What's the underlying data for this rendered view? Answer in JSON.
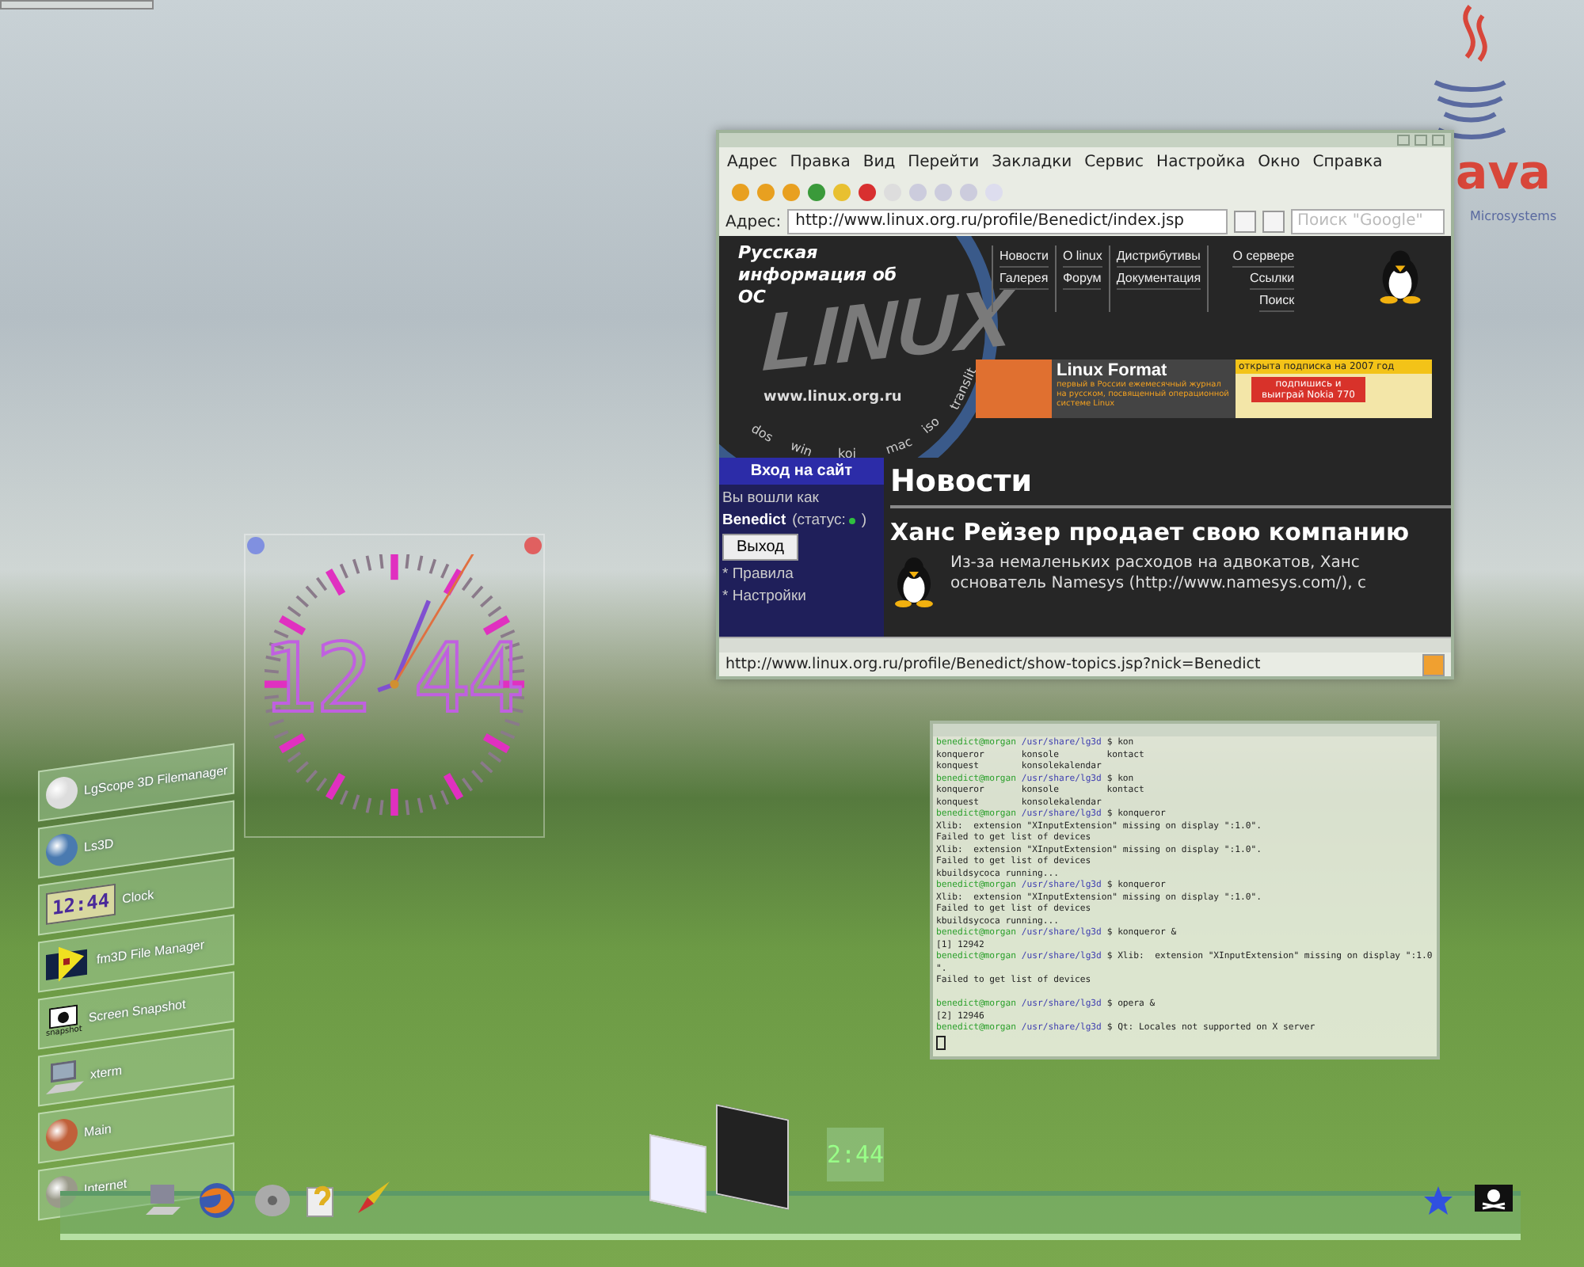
{
  "java_logo": {
    "wordmark": "ava",
    "company": "Microsystems"
  },
  "browser": {
    "menu": [
      "Адрес",
      "Правка",
      "Вид",
      "Перейти",
      "Закладки",
      "Сервис",
      "Настройка",
      "Окно",
      "Справка"
    ],
    "address_label": "Адрес:",
    "url": "http://www.linux.org.ru/profile/Benedict/index.jsp",
    "search_placeholder": "Поиск \"Google\"",
    "site": {
      "tagline": "Русская информация об ОС",
      "logo": "LINUX",
      "site_url": "www.linux.org.ru",
      "ring_words": [
        "dos",
        "win",
        "koi",
        "mac",
        "iso",
        "translit"
      ],
      "nav_columns": [
        [
          "Новости",
          "Галерея"
        ],
        [
          "О linux",
          "Форум"
        ],
        [
          "Дистрибутивы",
          "Документация"
        ],
        [
          "О сервере",
          "Ссылки",
          "Поиск"
        ]
      ],
      "banner": {
        "title": "Linux Format",
        "ribbon": "открыта подписка на 2007 год",
        "description": "первый в России ежемесячный журнал на русском, посвященный операционной системе Linux",
        "promo": "подпишись и выиграй Nokia 770"
      },
      "login": {
        "title": "Вход на сайт",
        "signed_in": "Вы вошли как",
        "user": "Benedict",
        "status_open": "(статус:",
        "status_dot": {
          "color": "#2fbf3f"
        },
        "status_close": ")",
        "logout": "Выход",
        "links": [
          "* Правила",
          "* Настройки"
        ]
      },
      "news_heading": "Новости",
      "article_title": "Ханс Рейзер продает свою компанию",
      "article_lines": [
        "Из-за немаленьких расходов на адвокатов, Ханс",
        "основатель Namesys (http://www.namesys.com/), с"
      ]
    },
    "status_url": "http://www.linux.org.ru/profile/Benedict/show-topics.jsp?nick=Benedict"
  },
  "clock_widget": {
    "hours": "12",
    "minutes": "44"
  },
  "terminal": {
    "lines": [
      {
        "kind": "prompt",
        "user": "benedict@morgan",
        "path": "/usr/share/lg3d",
        "symbol": "$",
        "command": "kon"
      },
      {
        "kind": "output",
        "text": "konqueror       konsole         kontact"
      },
      {
        "kind": "output",
        "text": "konquest        konsolekalendar"
      },
      {
        "kind": "prompt",
        "user": "benedict@morgan",
        "path": "/usr/share/lg3d",
        "symbol": "$",
        "command": "kon"
      },
      {
        "kind": "output",
        "text": "konqueror       konsole         kontact"
      },
      {
        "kind": "output",
        "text": "konquest        konsolekalendar"
      },
      {
        "kind": "prompt",
        "user": "benedict@morgan",
        "path": "/usr/share/lg3d",
        "symbol": "$",
        "command": "konqueror"
      },
      {
        "kind": "output",
        "text": "Xlib:  extension \"XInputExtension\" missing on display \":1.0\"."
      },
      {
        "kind": "output",
        "text": "Failed to get list of devices"
      },
      {
        "kind": "output",
        "text": "Xlib:  extension \"XInputExtension\" missing on display \":1.0\"."
      },
      {
        "kind": "output",
        "text": "Failed to get list of devices"
      },
      {
        "kind": "output",
        "text": "kbuildsycoca running..."
      },
      {
        "kind": "prompt",
        "user": "benedict@morgan",
        "path": "/usr/share/lg3d",
        "symbol": "$",
        "command": "konqueror"
      },
      {
        "kind": "output",
        "text": "Xlib:  extension \"XInputExtension\" missing on display \":1.0\"."
      },
      {
        "kind": "output",
        "text": "Failed to get list of devices"
      },
      {
        "kind": "output",
        "text": "kbuildsycoca running..."
      },
      {
        "kind": "prompt",
        "user": "benedict@morgan",
        "path": "/usr/share/lg3d",
        "symbol": "$",
        "command": "konqueror &"
      },
      {
        "kind": "output",
        "text": "[1] 12942"
      },
      {
        "kind": "prompt",
        "user": "benedict@morgan",
        "path": "/usr/share/lg3d",
        "symbol": "$",
        "command": "Xlib:  extension \"XInputExtension\" missing on display \":1.0"
      },
      {
        "kind": "output",
        "text": "\"."
      },
      {
        "kind": "output",
        "text": "Failed to get list of devices"
      },
      {
        "kind": "blank"
      },
      {
        "kind": "prompt",
        "user": "benedict@morgan",
        "path": "/usr/share/lg3d",
        "symbol": "$",
        "command": "opera &"
      },
      {
        "kind": "output",
        "text": "[2] 12946"
      },
      {
        "kind": "prompt",
        "user": "benedict@morgan",
        "path": "/usr/share/lg3d",
        "symbol": "$",
        "command": "Qt: Locales not supported on X server"
      },
      {
        "kind": "cursor"
      }
    ]
  },
  "launcher": [
    {
      "kind": "ball",
      "label": "LgScope 3D Filemanager"
    },
    {
      "kind": "eye",
      "label": "Ls3D"
    },
    {
      "kind": "lcd",
      "label": "Clock",
      "lcd_text": "12:44"
    },
    {
      "kind": "folder",
      "label": "fm3D File Manager"
    },
    {
      "kind": "camera",
      "label": "Screen Snapshot",
      "icon_caption": "snapshot"
    },
    {
      "kind": "monitor",
      "label": "xterm"
    },
    {
      "kind": "sphere",
      "label": "Main",
      "color": "#c0603a"
    },
    {
      "kind": "sphere",
      "label": "Internet",
      "color": "#9a9a8a"
    }
  ],
  "taskbar": {
    "clock": "2:44"
  }
}
